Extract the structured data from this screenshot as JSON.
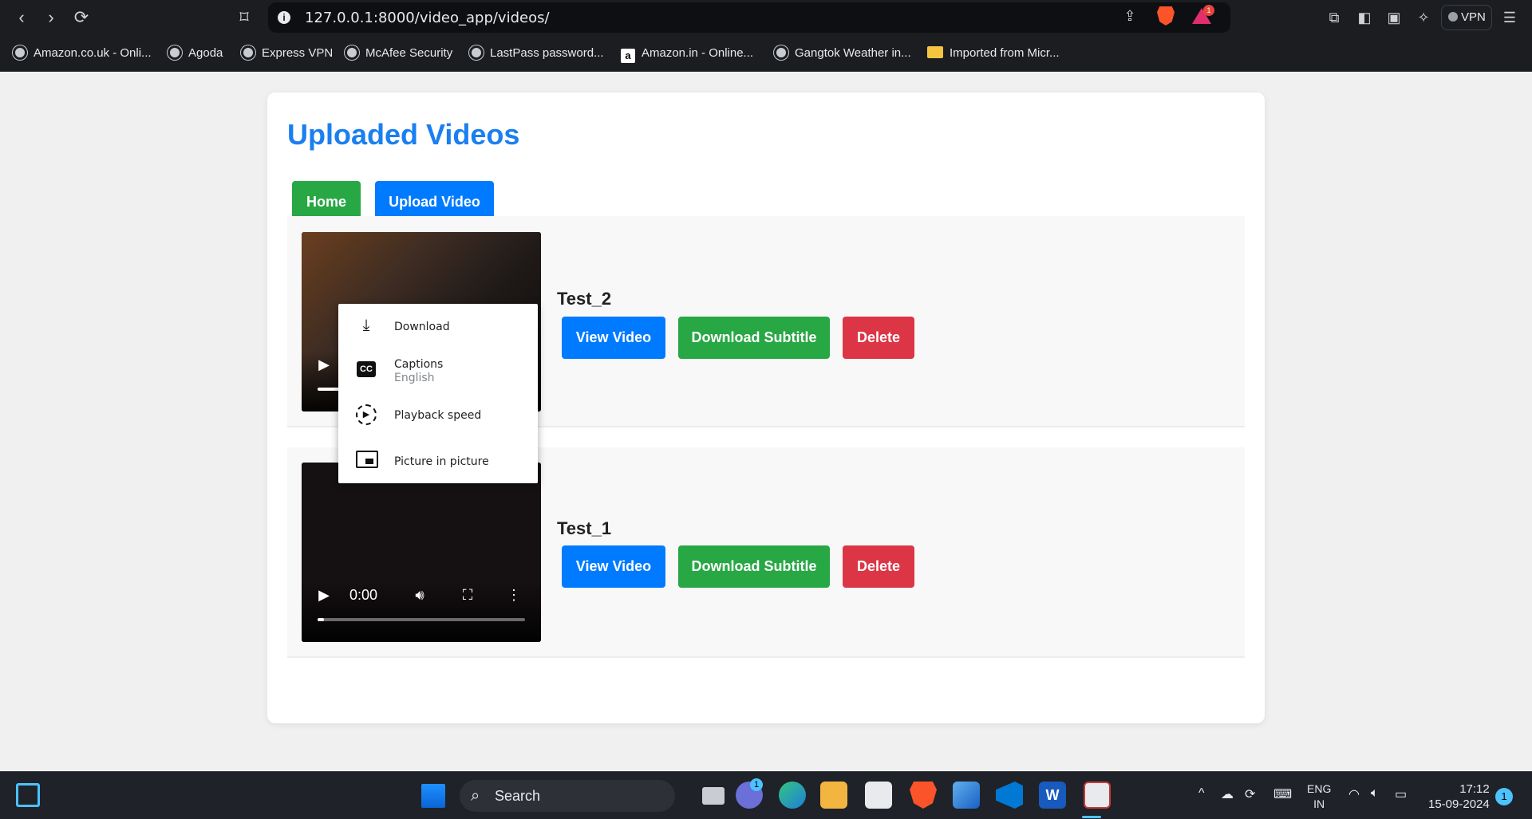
{
  "browser": {
    "url": "127.0.0.1:8000/video_app/videos/",
    "vpn_label": "VPN",
    "rewards_badge": "1",
    "bookmarks": [
      {
        "label": "Amazon.co.uk - Onli...",
        "icon": "globe-icon"
      },
      {
        "label": "Agoda",
        "icon": "globe-icon"
      },
      {
        "label": "Express VPN",
        "icon": "globe-icon"
      },
      {
        "label": "McAfee Security",
        "icon": "globe-icon"
      },
      {
        "label": "LastPass password...",
        "icon": "globe-icon"
      },
      {
        "label": "Amazon.in - Online...",
        "icon": "amazon-icon"
      },
      {
        "label": "Gangtok Weather in...",
        "icon": "globe-icon"
      },
      {
        "label": "Imported from Micr...",
        "icon": "folder-icon"
      }
    ]
  },
  "page": {
    "title": "Uploaded Videos",
    "home_label": "Home",
    "upload_label": "Upload Video"
  },
  "videos": [
    {
      "title": "Test_2",
      "view_label": "View Video",
      "subtitle_label": "Download Subtitle",
      "delete_label": "Delete",
      "progress": 0.16
    },
    {
      "title": "Test_1",
      "view_label": "View Video",
      "subtitle_label": "Download Subtitle",
      "delete_label": "Delete",
      "time": "0:00",
      "progress": 0.03
    }
  ],
  "context_menu": {
    "items": [
      {
        "label": "Download",
        "icon": "download-icon"
      },
      {
        "label": "Captions",
        "sub": "English",
        "icon": "captions-icon"
      },
      {
        "label": "Playback speed",
        "icon": "playback-speed-icon"
      },
      {
        "label": "Picture in picture",
        "icon": "picture-in-picture-icon"
      }
    ]
  },
  "taskbar": {
    "search_label": "Search",
    "teams_badge": "1",
    "lang_line1": "ENG",
    "lang_line2": "IN",
    "time": "17:12",
    "date": "15-09-2024",
    "notification_count": "1"
  },
  "colors": {
    "title_blue": "#1a7ff0",
    "button_blue": "#007bff",
    "button_green": "#28a745",
    "button_red": "#dc3545"
  }
}
